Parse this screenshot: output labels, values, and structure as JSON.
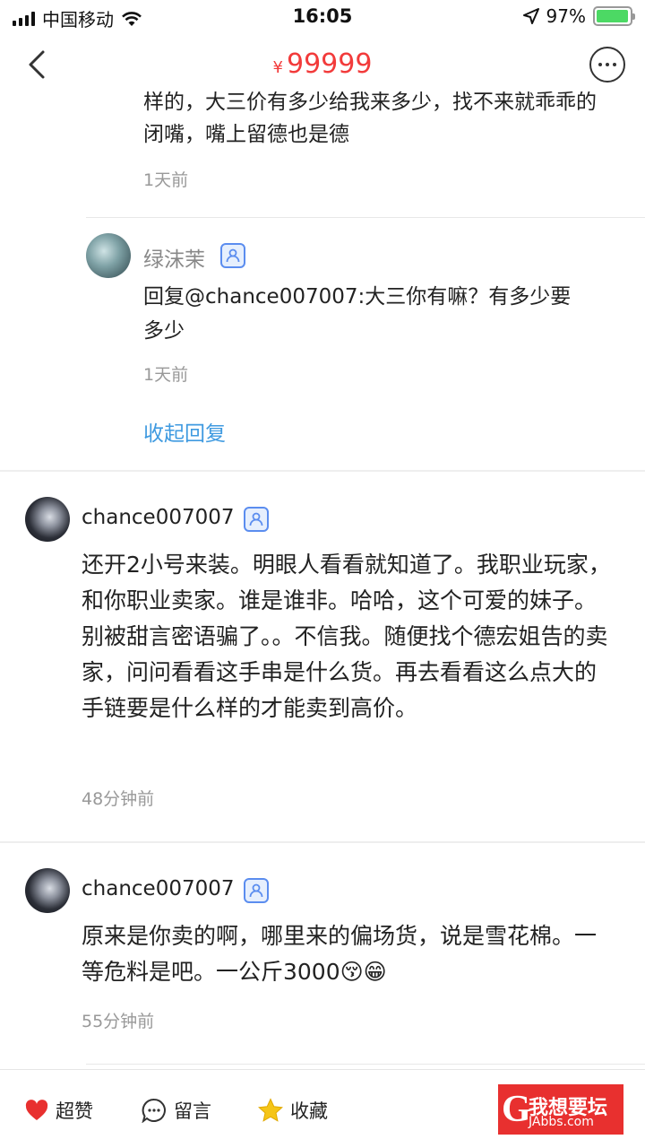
{
  "status_bar": {
    "carrier": "中国移动",
    "time": "16:05",
    "battery_pct": "97%",
    "battery_level": 0.97
  },
  "header": {
    "currency": "¥",
    "price": "99999"
  },
  "thread": {
    "clipped_text": "样的，大三价有多少给我来多少，找不来就乖乖的闭嘴，嘴上留德也是德",
    "clipped_time": "1天前",
    "reply": {
      "username": "绿沫茉",
      "text": "回复@chance007007:大三你有嘛？有多少要多少",
      "time": "1天前",
      "collapse_label": "收起回复"
    }
  },
  "comments": [
    {
      "username": "chance007007",
      "text": "还开2小号来装。明眼人看看就知道了。我职业玩家，和你职业卖家。谁是谁非。哈哈，这个可爱的妹子。别被甜言密语骗了。。不信我。随便找个德宏姐告的卖家，问问看看这手串是什么货。再去看看这么点大的手链要是什么样的才能卖到高价。",
      "time": "48分钟前"
    },
    {
      "username": "chance007007",
      "text": "原来是你卖的啊，哪里来的偏场货，说是雪花棉。一等危料是吧。一公斤3000😚😁",
      "time": "55分钟前"
    }
  ],
  "bottom_bar": {
    "like_label": "超赞",
    "comment_label": "留言",
    "favorite_label": "收藏",
    "watermark_text": "我想要坛",
    "watermark_sub": "JAbbs.com"
  },
  "colors": {
    "price_red": "#f23b3b",
    "link_blue": "#3f9ae0",
    "badge_blue": "#5b8def",
    "battery_green": "#4cd964",
    "heart_red": "#e8302f",
    "star_yellow": "#f5c518"
  }
}
